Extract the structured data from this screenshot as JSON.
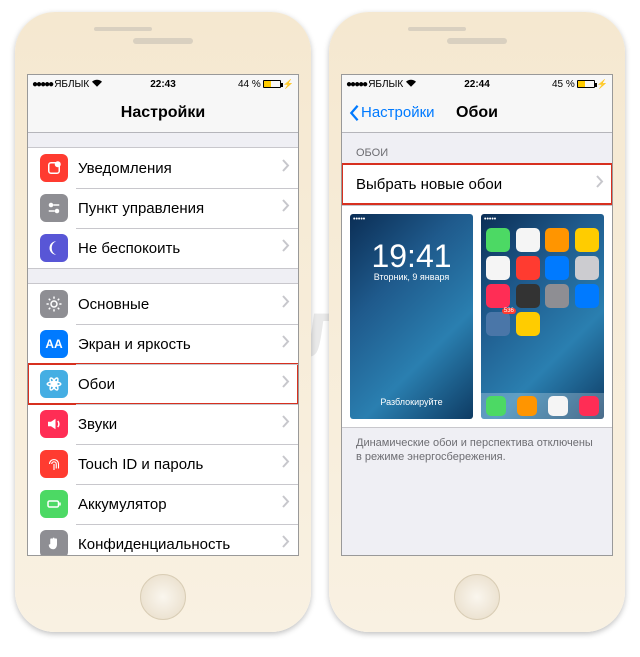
{
  "watermark": "блык",
  "iconApple": "apple-logo",
  "left": {
    "status": {
      "carrier": "ЯБЛЫК",
      "time": "22:43",
      "battery_pct": "44 %",
      "battery_level": 44
    },
    "title": "Настройки",
    "group1": [
      {
        "name": "notifications",
        "label": "Уведомления",
        "color": "#ff3b30",
        "icon": "notifications"
      },
      {
        "name": "control-center",
        "label": "Пункт управления",
        "color": "#8e8e93",
        "icon": "sliders"
      },
      {
        "name": "dnd",
        "label": "Не беспокоить",
        "color": "#5856d6",
        "icon": "moon"
      }
    ],
    "group2": [
      {
        "name": "general",
        "label": "Основные",
        "color": "#8e8e93",
        "icon": "gear"
      },
      {
        "name": "display",
        "label": "Экран и яркость",
        "color": "#007aff",
        "icon": "aa"
      },
      {
        "name": "wallpaper",
        "label": "Обои",
        "color": "#45aee3",
        "icon": "flower",
        "highlight": true
      },
      {
        "name": "sounds",
        "label": "Звуки",
        "color": "#ff2d55",
        "icon": "speaker"
      },
      {
        "name": "touch-id",
        "label": "Touch ID и пароль",
        "color": "#ff3b30",
        "icon": "fingerprint"
      },
      {
        "name": "battery",
        "label": "Аккумулятор",
        "color": "#4cd964",
        "icon": "battery"
      },
      {
        "name": "privacy",
        "label": "Конфиденциальность",
        "color": "#8e8e93",
        "icon": "hand"
      }
    ]
  },
  "right": {
    "status": {
      "carrier": "ЯБЛЫК",
      "time": "22:44",
      "battery_pct": "45 %",
      "battery_level": 45
    },
    "back_label": "Настройки",
    "title": "Обои",
    "section_header": "ОБОИ",
    "choose_label": "Выбрать новые обои",
    "lock_preview": {
      "time": "19:41",
      "date": "Вторник, 9 января",
      "unlock": "Разблокируйте"
    },
    "footnote": "Динамические обои и перспектива отключены в режиме энергосбережения.",
    "home_apps": [
      "#4cd964",
      "#f5f5f5",
      "#ff9500",
      "#ffcc00",
      "#f5f5f5",
      "#ff3b30",
      "#007aff",
      "#ccccd0",
      "#ff2d55",
      "#333333",
      "#8e8e93",
      "#007aff",
      "#4a76a8",
      "#ffcc00"
    ],
    "dock_apps": [
      "#4cd964",
      "#ff9500",
      "#f5f5f5",
      "#ff2d55"
    ],
    "badge": "536"
  }
}
